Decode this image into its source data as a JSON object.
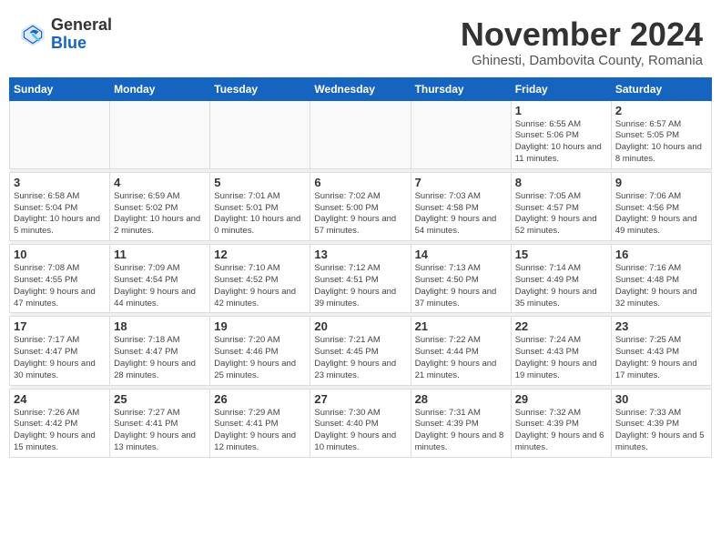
{
  "header": {
    "logo_line1": "General",
    "logo_line2": "Blue",
    "title": "November 2024",
    "subtitle": "Ghinesti, Dambovita County, Romania"
  },
  "days_of_week": [
    "Sunday",
    "Monday",
    "Tuesday",
    "Wednesday",
    "Thursday",
    "Friday",
    "Saturday"
  ],
  "weeks": [
    {
      "days": [
        {
          "num": "",
          "info": ""
        },
        {
          "num": "",
          "info": ""
        },
        {
          "num": "",
          "info": ""
        },
        {
          "num": "",
          "info": ""
        },
        {
          "num": "",
          "info": ""
        },
        {
          "num": "1",
          "info": "Sunrise: 6:55 AM\nSunset: 5:06 PM\nDaylight: 10 hours and 11 minutes."
        },
        {
          "num": "2",
          "info": "Sunrise: 6:57 AM\nSunset: 5:05 PM\nDaylight: 10 hours and 8 minutes."
        }
      ]
    },
    {
      "days": [
        {
          "num": "3",
          "info": "Sunrise: 6:58 AM\nSunset: 5:04 PM\nDaylight: 10 hours and 5 minutes."
        },
        {
          "num": "4",
          "info": "Sunrise: 6:59 AM\nSunset: 5:02 PM\nDaylight: 10 hours and 2 minutes."
        },
        {
          "num": "5",
          "info": "Sunrise: 7:01 AM\nSunset: 5:01 PM\nDaylight: 10 hours and 0 minutes."
        },
        {
          "num": "6",
          "info": "Sunrise: 7:02 AM\nSunset: 5:00 PM\nDaylight: 9 hours and 57 minutes."
        },
        {
          "num": "7",
          "info": "Sunrise: 7:03 AM\nSunset: 4:58 PM\nDaylight: 9 hours and 54 minutes."
        },
        {
          "num": "8",
          "info": "Sunrise: 7:05 AM\nSunset: 4:57 PM\nDaylight: 9 hours and 52 minutes."
        },
        {
          "num": "9",
          "info": "Sunrise: 7:06 AM\nSunset: 4:56 PM\nDaylight: 9 hours and 49 minutes."
        }
      ]
    },
    {
      "days": [
        {
          "num": "10",
          "info": "Sunrise: 7:08 AM\nSunset: 4:55 PM\nDaylight: 9 hours and 47 minutes."
        },
        {
          "num": "11",
          "info": "Sunrise: 7:09 AM\nSunset: 4:54 PM\nDaylight: 9 hours and 44 minutes."
        },
        {
          "num": "12",
          "info": "Sunrise: 7:10 AM\nSunset: 4:52 PM\nDaylight: 9 hours and 42 minutes."
        },
        {
          "num": "13",
          "info": "Sunrise: 7:12 AM\nSunset: 4:51 PM\nDaylight: 9 hours and 39 minutes."
        },
        {
          "num": "14",
          "info": "Sunrise: 7:13 AM\nSunset: 4:50 PM\nDaylight: 9 hours and 37 minutes."
        },
        {
          "num": "15",
          "info": "Sunrise: 7:14 AM\nSunset: 4:49 PM\nDaylight: 9 hours and 35 minutes."
        },
        {
          "num": "16",
          "info": "Sunrise: 7:16 AM\nSunset: 4:48 PM\nDaylight: 9 hours and 32 minutes."
        }
      ]
    },
    {
      "days": [
        {
          "num": "17",
          "info": "Sunrise: 7:17 AM\nSunset: 4:47 PM\nDaylight: 9 hours and 30 minutes."
        },
        {
          "num": "18",
          "info": "Sunrise: 7:18 AM\nSunset: 4:47 PM\nDaylight: 9 hours and 28 minutes."
        },
        {
          "num": "19",
          "info": "Sunrise: 7:20 AM\nSunset: 4:46 PM\nDaylight: 9 hours and 25 minutes."
        },
        {
          "num": "20",
          "info": "Sunrise: 7:21 AM\nSunset: 4:45 PM\nDaylight: 9 hours and 23 minutes."
        },
        {
          "num": "21",
          "info": "Sunrise: 7:22 AM\nSunset: 4:44 PM\nDaylight: 9 hours and 21 minutes."
        },
        {
          "num": "22",
          "info": "Sunrise: 7:24 AM\nSunset: 4:43 PM\nDaylight: 9 hours and 19 minutes."
        },
        {
          "num": "23",
          "info": "Sunrise: 7:25 AM\nSunset: 4:43 PM\nDaylight: 9 hours and 17 minutes."
        }
      ]
    },
    {
      "days": [
        {
          "num": "24",
          "info": "Sunrise: 7:26 AM\nSunset: 4:42 PM\nDaylight: 9 hours and 15 minutes."
        },
        {
          "num": "25",
          "info": "Sunrise: 7:27 AM\nSunset: 4:41 PM\nDaylight: 9 hours and 13 minutes."
        },
        {
          "num": "26",
          "info": "Sunrise: 7:29 AM\nSunset: 4:41 PM\nDaylight: 9 hours and 12 minutes."
        },
        {
          "num": "27",
          "info": "Sunrise: 7:30 AM\nSunset: 4:40 PM\nDaylight: 9 hours and 10 minutes."
        },
        {
          "num": "28",
          "info": "Sunrise: 7:31 AM\nSunset: 4:39 PM\nDaylight: 9 hours and 8 minutes."
        },
        {
          "num": "29",
          "info": "Sunrise: 7:32 AM\nSunset: 4:39 PM\nDaylight: 9 hours and 6 minutes."
        },
        {
          "num": "30",
          "info": "Sunrise: 7:33 AM\nSunset: 4:39 PM\nDaylight: 9 hours and 5 minutes."
        }
      ]
    }
  ]
}
